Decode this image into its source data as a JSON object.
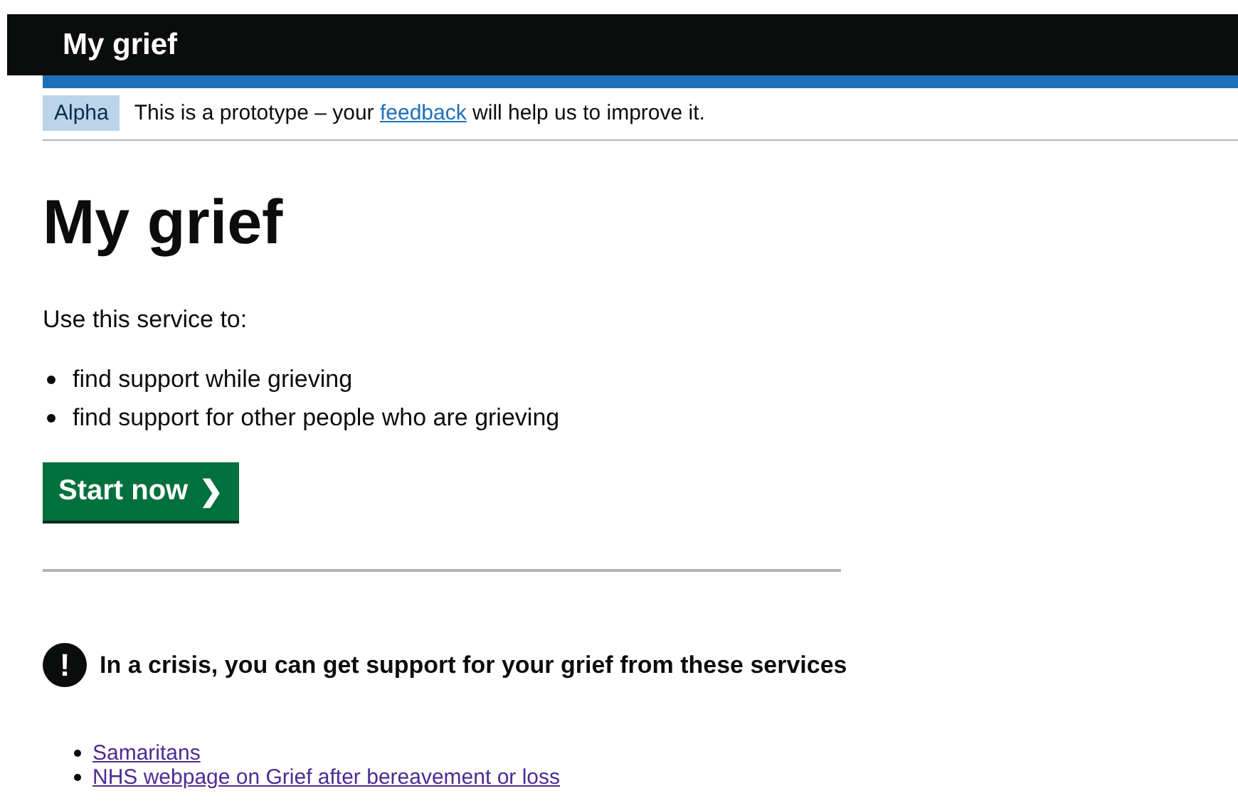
{
  "header": {
    "service_name": "My grief"
  },
  "phase_banner": {
    "tag": "Alpha",
    "text_before": "This is a prototype – your",
    "link": "feedback",
    "text_after": "will help us to improve it."
  },
  "title": "My grief",
  "intro": "Use this service to:",
  "uses": [
    "find support while grieving",
    "find support for other people who are grieving"
  ],
  "start_button": {
    "label": "Start now",
    "arrow": "❯"
  },
  "warning": {
    "icon": "!",
    "text": "In a crisis, you can get support for your grief from these services"
  },
  "links": [
    {
      "label": "Samaritans",
      "visited": true
    },
    {
      "label": "NHS webpage on Grief after bereavement or loss",
      "visited": true
    }
  ]
}
